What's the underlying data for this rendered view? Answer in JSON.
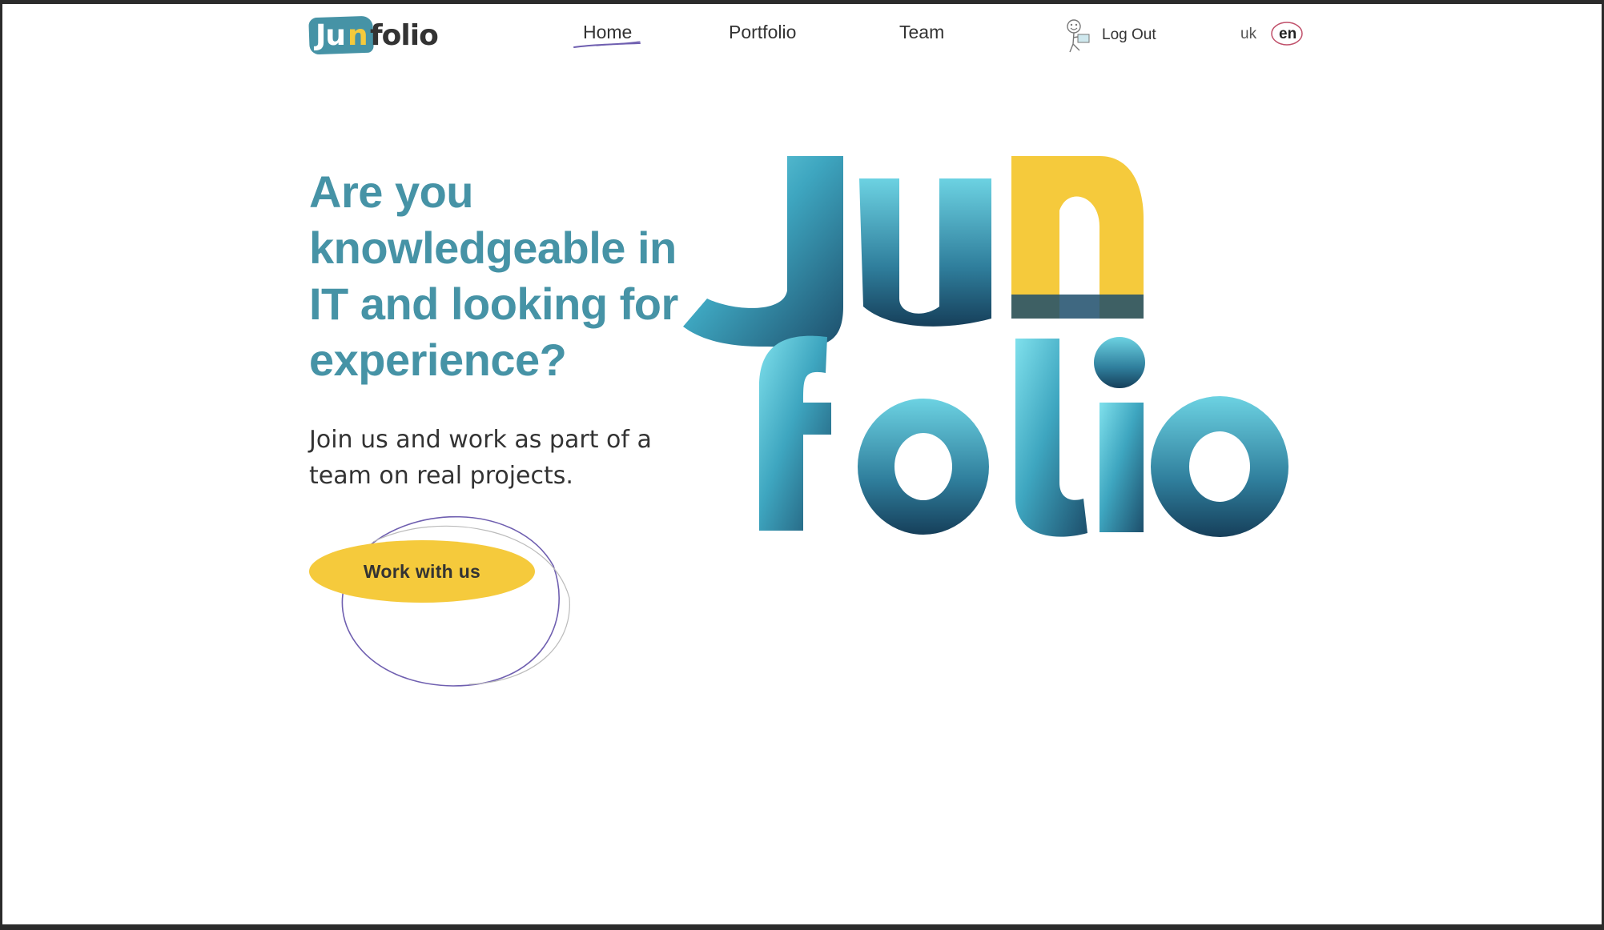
{
  "header": {
    "logo": {
      "part1": "Ju",
      "part2": "n",
      "part3": "folio"
    },
    "nav": [
      {
        "label": "Home",
        "active": true
      },
      {
        "label": "Portfolio",
        "active": false
      },
      {
        "label": "Team",
        "active": false
      }
    ],
    "logout_label": "Log Out",
    "languages": [
      {
        "code": "uk",
        "active": false
      },
      {
        "code": "en",
        "active": true
      }
    ]
  },
  "hero": {
    "headline": "Are you knowledgeable in IT and looking for experience?",
    "subtext": "Join us and work as part of a team on real projects.",
    "cta_label": "Work with us",
    "art_word_top": "Jun",
    "art_word_bottom": "folio"
  },
  "colors": {
    "teal": "#4693a6",
    "yellow": "#f5ca3c",
    "dark_teal": "#1d4e6b",
    "light_cyan": "#7fe0ec",
    "accent_purple": "#6f5fb0",
    "accent_pink": "#c0506a"
  }
}
